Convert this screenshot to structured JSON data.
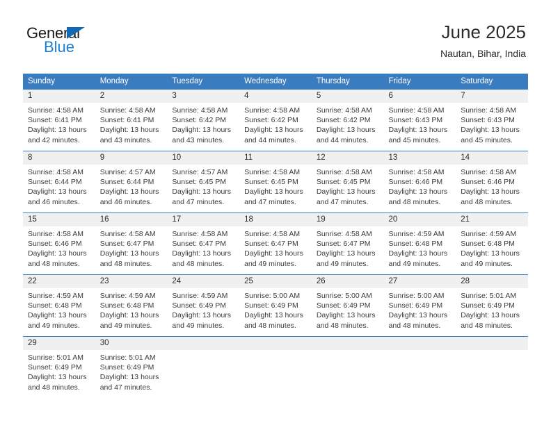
{
  "brand": {
    "name_top": "General",
    "name_bottom": "Blue",
    "accent_color": "#1a7fd4",
    "triangle_color": "#1469b3"
  },
  "header": {
    "title": "June 2025",
    "subtitle": "Nautan, Bihar, India"
  },
  "calendar": {
    "header_bg": "#3a7cc0",
    "daynum_bg": "#f0f0f0",
    "weekdays": [
      "Sunday",
      "Monday",
      "Tuesday",
      "Wednesday",
      "Thursday",
      "Friday",
      "Saturday"
    ],
    "labels": {
      "sunrise": "Sunrise:",
      "sunset": "Sunset:",
      "daylight": "Daylight:"
    },
    "weeks": [
      [
        {
          "day": "1",
          "sunrise": "Sunrise: 4:58 AM",
          "sunset": "Sunset: 6:41 PM",
          "daylight": "Daylight: 13 hours and 42 minutes."
        },
        {
          "day": "2",
          "sunrise": "Sunrise: 4:58 AM",
          "sunset": "Sunset: 6:41 PM",
          "daylight": "Daylight: 13 hours and 43 minutes."
        },
        {
          "day": "3",
          "sunrise": "Sunrise: 4:58 AM",
          "sunset": "Sunset: 6:42 PM",
          "daylight": "Daylight: 13 hours and 43 minutes."
        },
        {
          "day": "4",
          "sunrise": "Sunrise: 4:58 AM",
          "sunset": "Sunset: 6:42 PM",
          "daylight": "Daylight: 13 hours and 44 minutes."
        },
        {
          "day": "5",
          "sunrise": "Sunrise: 4:58 AM",
          "sunset": "Sunset: 6:42 PM",
          "daylight": "Daylight: 13 hours and 44 minutes."
        },
        {
          "day": "6",
          "sunrise": "Sunrise: 4:58 AM",
          "sunset": "Sunset: 6:43 PM",
          "daylight": "Daylight: 13 hours and 45 minutes."
        },
        {
          "day": "7",
          "sunrise": "Sunrise: 4:58 AM",
          "sunset": "Sunset: 6:43 PM",
          "daylight": "Daylight: 13 hours and 45 minutes."
        }
      ],
      [
        {
          "day": "8",
          "sunrise": "Sunrise: 4:58 AM",
          "sunset": "Sunset: 6:44 PM",
          "daylight": "Daylight: 13 hours and 46 minutes."
        },
        {
          "day": "9",
          "sunrise": "Sunrise: 4:57 AM",
          "sunset": "Sunset: 6:44 PM",
          "daylight": "Daylight: 13 hours and 46 minutes."
        },
        {
          "day": "10",
          "sunrise": "Sunrise: 4:57 AM",
          "sunset": "Sunset: 6:45 PM",
          "daylight": "Daylight: 13 hours and 47 minutes."
        },
        {
          "day": "11",
          "sunrise": "Sunrise: 4:58 AM",
          "sunset": "Sunset: 6:45 PM",
          "daylight": "Daylight: 13 hours and 47 minutes."
        },
        {
          "day": "12",
          "sunrise": "Sunrise: 4:58 AM",
          "sunset": "Sunset: 6:45 PM",
          "daylight": "Daylight: 13 hours and 47 minutes."
        },
        {
          "day": "13",
          "sunrise": "Sunrise: 4:58 AM",
          "sunset": "Sunset: 6:46 PM",
          "daylight": "Daylight: 13 hours and 48 minutes."
        },
        {
          "day": "14",
          "sunrise": "Sunrise: 4:58 AM",
          "sunset": "Sunset: 6:46 PM",
          "daylight": "Daylight: 13 hours and 48 minutes."
        }
      ],
      [
        {
          "day": "15",
          "sunrise": "Sunrise: 4:58 AM",
          "sunset": "Sunset: 6:46 PM",
          "daylight": "Daylight: 13 hours and 48 minutes."
        },
        {
          "day": "16",
          "sunrise": "Sunrise: 4:58 AM",
          "sunset": "Sunset: 6:47 PM",
          "daylight": "Daylight: 13 hours and 48 minutes."
        },
        {
          "day": "17",
          "sunrise": "Sunrise: 4:58 AM",
          "sunset": "Sunset: 6:47 PM",
          "daylight": "Daylight: 13 hours and 48 minutes."
        },
        {
          "day": "18",
          "sunrise": "Sunrise: 4:58 AM",
          "sunset": "Sunset: 6:47 PM",
          "daylight": "Daylight: 13 hours and 49 minutes."
        },
        {
          "day": "19",
          "sunrise": "Sunrise: 4:58 AM",
          "sunset": "Sunset: 6:47 PM",
          "daylight": "Daylight: 13 hours and 49 minutes."
        },
        {
          "day": "20",
          "sunrise": "Sunrise: 4:59 AM",
          "sunset": "Sunset: 6:48 PM",
          "daylight": "Daylight: 13 hours and 49 minutes."
        },
        {
          "day": "21",
          "sunrise": "Sunrise: 4:59 AM",
          "sunset": "Sunset: 6:48 PM",
          "daylight": "Daylight: 13 hours and 49 minutes."
        }
      ],
      [
        {
          "day": "22",
          "sunrise": "Sunrise: 4:59 AM",
          "sunset": "Sunset: 6:48 PM",
          "daylight": "Daylight: 13 hours and 49 minutes."
        },
        {
          "day": "23",
          "sunrise": "Sunrise: 4:59 AM",
          "sunset": "Sunset: 6:48 PM",
          "daylight": "Daylight: 13 hours and 49 minutes."
        },
        {
          "day": "24",
          "sunrise": "Sunrise: 4:59 AM",
          "sunset": "Sunset: 6:49 PM",
          "daylight": "Daylight: 13 hours and 49 minutes."
        },
        {
          "day": "25",
          "sunrise": "Sunrise: 5:00 AM",
          "sunset": "Sunset: 6:49 PM",
          "daylight": "Daylight: 13 hours and 48 minutes."
        },
        {
          "day": "26",
          "sunrise": "Sunrise: 5:00 AM",
          "sunset": "Sunset: 6:49 PM",
          "daylight": "Daylight: 13 hours and 48 minutes."
        },
        {
          "day": "27",
          "sunrise": "Sunrise: 5:00 AM",
          "sunset": "Sunset: 6:49 PM",
          "daylight": "Daylight: 13 hours and 48 minutes."
        },
        {
          "day": "28",
          "sunrise": "Sunrise: 5:01 AM",
          "sunset": "Sunset: 6:49 PM",
          "daylight": "Daylight: 13 hours and 48 minutes."
        }
      ],
      [
        {
          "day": "29",
          "sunrise": "Sunrise: 5:01 AM",
          "sunset": "Sunset: 6:49 PM",
          "daylight": "Daylight: 13 hours and 48 minutes."
        },
        {
          "day": "30",
          "sunrise": "Sunrise: 5:01 AM",
          "sunset": "Sunset: 6:49 PM",
          "daylight": "Daylight: 13 hours and 47 minutes."
        },
        {
          "day": "",
          "sunrise": "",
          "sunset": "",
          "daylight": ""
        },
        {
          "day": "",
          "sunrise": "",
          "sunset": "",
          "daylight": ""
        },
        {
          "day": "",
          "sunrise": "",
          "sunset": "",
          "daylight": ""
        },
        {
          "day": "",
          "sunrise": "",
          "sunset": "",
          "daylight": ""
        },
        {
          "day": "",
          "sunrise": "",
          "sunset": "",
          "daylight": ""
        }
      ]
    ]
  }
}
